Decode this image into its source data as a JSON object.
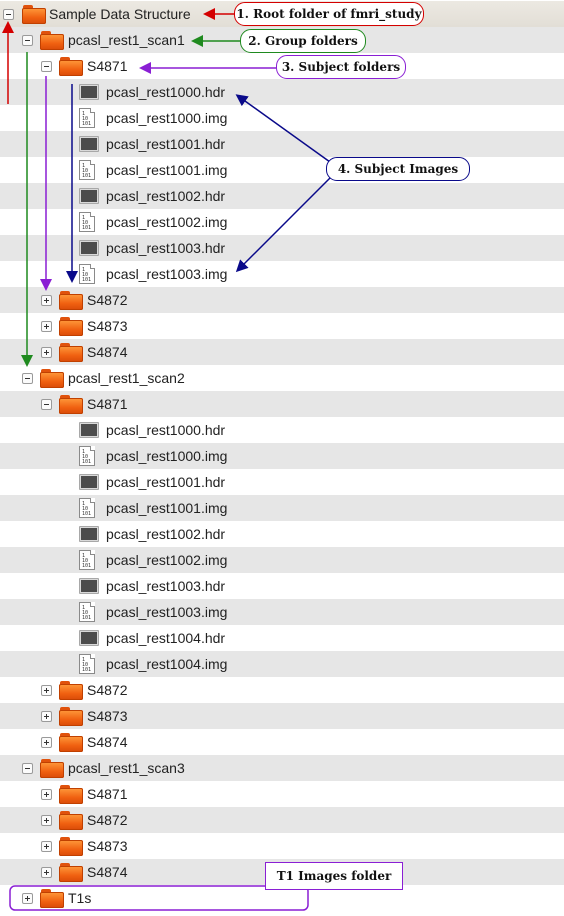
{
  "tree": [
    {
      "label": "Sample Data Structure",
      "type": "folder",
      "level": 0,
      "toggle": "minus"
    },
    {
      "label": "pcasl_rest1_scan1",
      "type": "folder",
      "level": 1,
      "toggle": "minus"
    },
    {
      "label": "S4871",
      "type": "folder",
      "level": 2,
      "toggle": "minus"
    },
    {
      "label": "pcasl_rest1000.hdr",
      "type": "hdr",
      "level": 3
    },
    {
      "label": "pcasl_rest1000.img",
      "type": "img",
      "level": 3
    },
    {
      "label": "pcasl_rest1001.hdr",
      "type": "hdr",
      "level": 3
    },
    {
      "label": "pcasl_rest1001.img",
      "type": "img",
      "level": 3
    },
    {
      "label": "pcasl_rest1002.hdr",
      "type": "hdr",
      "level": 3
    },
    {
      "label": "pcasl_rest1002.img",
      "type": "img",
      "level": 3
    },
    {
      "label": "pcasl_rest1003.hdr",
      "type": "hdr",
      "level": 3
    },
    {
      "label": "pcasl_rest1003.img",
      "type": "img",
      "level": 3
    },
    {
      "label": "S4872",
      "type": "folder",
      "level": 2,
      "toggle": "plus"
    },
    {
      "label": "S4873",
      "type": "folder",
      "level": 2,
      "toggle": "plus"
    },
    {
      "label": "S4874",
      "type": "folder",
      "level": 2,
      "toggle": "plus"
    },
    {
      "label": "pcasl_rest1_scan2",
      "type": "folder",
      "level": 1,
      "toggle": "minus"
    },
    {
      "label": "S4871",
      "type": "folder",
      "level": 2,
      "toggle": "minus"
    },
    {
      "label": "pcasl_rest1000.hdr",
      "type": "hdr",
      "level": 3
    },
    {
      "label": "pcasl_rest1000.img",
      "type": "img",
      "level": 3
    },
    {
      "label": "pcasl_rest1001.hdr",
      "type": "hdr",
      "level": 3
    },
    {
      "label": "pcasl_rest1001.img",
      "type": "img",
      "level": 3
    },
    {
      "label": "pcasl_rest1002.hdr",
      "type": "hdr",
      "level": 3
    },
    {
      "label": "pcasl_rest1002.img",
      "type": "img",
      "level": 3
    },
    {
      "label": "pcasl_rest1003.hdr",
      "type": "hdr",
      "level": 3
    },
    {
      "label": "pcasl_rest1003.img",
      "type": "img",
      "level": 3
    },
    {
      "label": "pcasl_rest1004.hdr",
      "type": "hdr",
      "level": 3
    },
    {
      "label": "pcasl_rest1004.img",
      "type": "img",
      "level": 3
    },
    {
      "label": "S4872",
      "type": "folder",
      "level": 2,
      "toggle": "plus"
    },
    {
      "label": "S4873",
      "type": "folder",
      "level": 2,
      "toggle": "plus"
    },
    {
      "label": "S4874",
      "type": "folder",
      "level": 2,
      "toggle": "plus"
    },
    {
      "label": "pcasl_rest1_scan3",
      "type": "folder",
      "level": 1,
      "toggle": "minus"
    },
    {
      "label": "S4871",
      "type": "folder",
      "level": 2,
      "toggle": "plus"
    },
    {
      "label": "S4872",
      "type": "folder",
      "level": 2,
      "toggle": "plus"
    },
    {
      "label": "S4873",
      "type": "folder",
      "level": 2,
      "toggle": "plus"
    },
    {
      "label": "S4874",
      "type": "folder",
      "level": 2,
      "toggle": "plus"
    },
    {
      "label": "T1s",
      "type": "folder",
      "level": 1,
      "toggle": "plus"
    }
  ],
  "img_icon_text": "1\n10\n101",
  "callouts": {
    "root": "1. Root folder of fmri_study",
    "group": "2. Group folders",
    "subject": "3. Subject folders",
    "images": "4. Subject Images",
    "t1": "T1 Images folder"
  },
  "colors": {
    "root": "#d40000",
    "group": "#1f8a1f",
    "subject": "#8a1fd4",
    "images": "#0a0a8a",
    "t1": "#8a1fd4"
  }
}
